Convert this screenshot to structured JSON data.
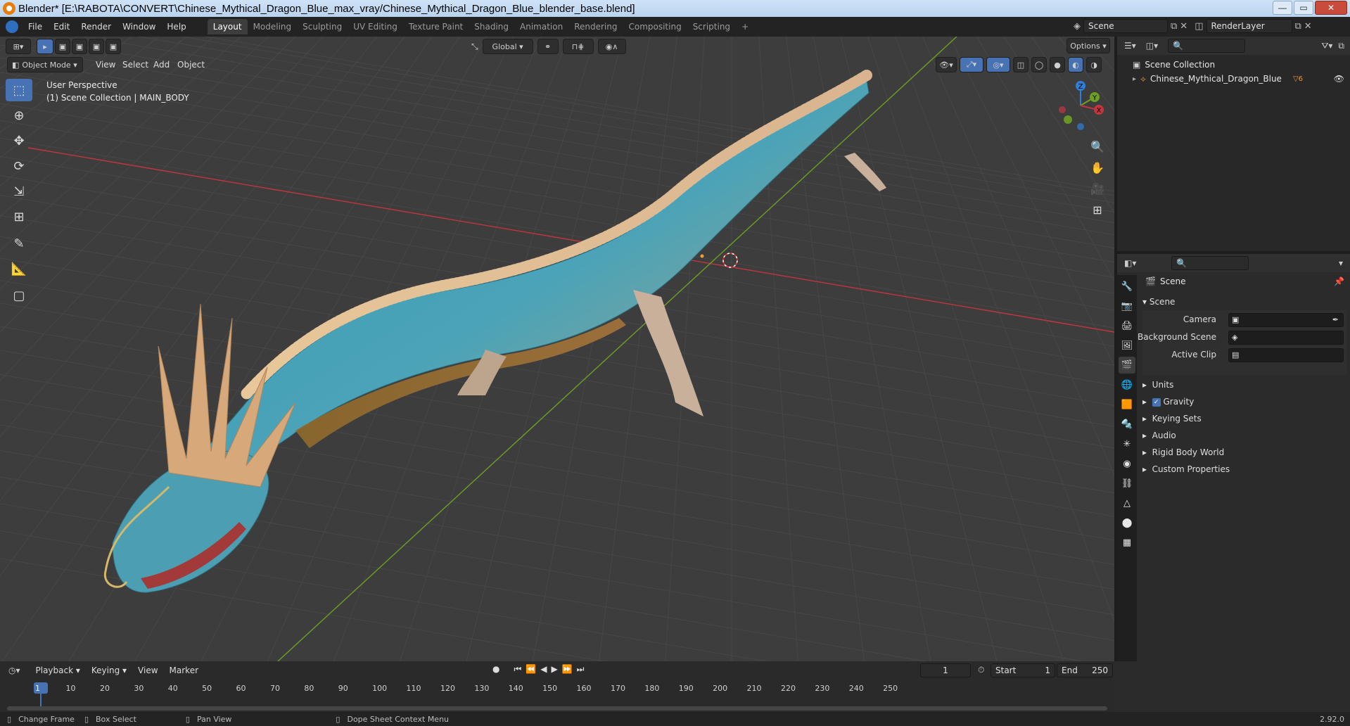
{
  "window": {
    "title": "Blender* [E:\\RABOTA\\CONVERT\\Chinese_Mythical_Dragon_Blue_max_vray/Chinese_Mythical_Dragon_Blue_blender_base.blend]",
    "btn_min": "—",
    "btn_max": "▭",
    "btn_close": "✕"
  },
  "menu": {
    "items": [
      "File",
      "Edit",
      "Render",
      "Window",
      "Help"
    ],
    "workspaces": [
      "Layout",
      "Modeling",
      "Sculpting",
      "UV Editing",
      "Texture Paint",
      "Shading",
      "Animation",
      "Rendering",
      "Compositing",
      "Scripting"
    ],
    "active_workspace": "Layout",
    "add_tab": "+",
    "scene": "Scene",
    "view_layer": "RenderLayer"
  },
  "viewport": {
    "mode": "Object Mode",
    "menus": [
      "View",
      "Select",
      "Add",
      "Object"
    ],
    "orientation": "Global",
    "options": "Options",
    "view_name": "User Perspective",
    "collection_info": "(1) Scene Collection | MAIN_BODY",
    "gizmo": {
      "x": "X",
      "y": "Y",
      "z": "Z"
    }
  },
  "outliner": {
    "root": "Scene Collection",
    "items": [
      {
        "label": "Chinese_Mythical_Dragon_Blue",
        "badge": "6"
      }
    ]
  },
  "properties": {
    "context": "Scene",
    "panel_title": "Scene",
    "fields": [
      {
        "label": "Camera"
      },
      {
        "label": "Background Scene"
      },
      {
        "label": "Active Clip"
      }
    ],
    "subpanels": [
      "Units",
      "Gravity",
      "Keying Sets",
      "Audio",
      "Rigid Body World",
      "Custom Properties"
    ],
    "gravity_checked": true
  },
  "timeline": {
    "menus": [
      "Playback",
      "Keying",
      "View",
      "Marker"
    ],
    "current_frame": "1",
    "start_label": "Start",
    "start": "1",
    "end_label": "End",
    "end": "250",
    "ticks": [
      "1",
      "10",
      "20",
      "30",
      "40",
      "50",
      "60",
      "70",
      "80",
      "90",
      "100",
      "110",
      "120",
      "130",
      "140",
      "150",
      "160",
      "170",
      "180",
      "190",
      "200",
      "210",
      "220",
      "230",
      "240",
      "250"
    ]
  },
  "status": {
    "hints": [
      "Change Frame",
      "Box Select",
      "Pan View",
      "Dope Sheet Context Menu"
    ],
    "version": "2.92.0"
  },
  "colors": {
    "accent": "#4772b3",
    "x_axis": "#c1363f",
    "y_axis": "#6e9f24",
    "z_axis": "#2f7fd6"
  }
}
